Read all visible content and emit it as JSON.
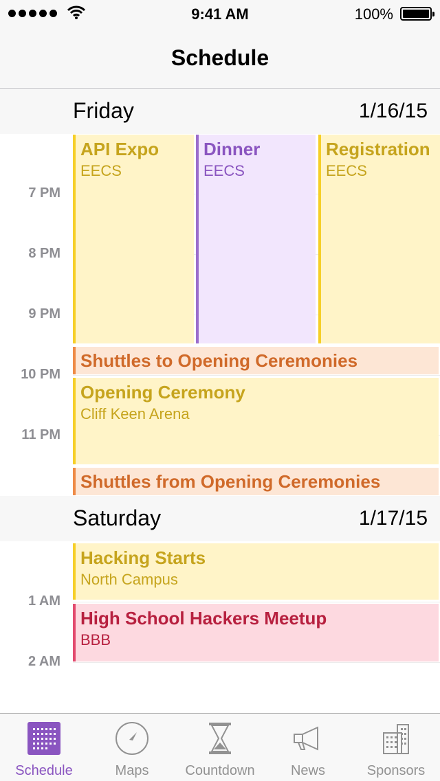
{
  "status_bar": {
    "time": "9:41 AM",
    "battery": "100%",
    "signal_icon": "signal-dots-icon",
    "wifi_icon": "wifi-icon",
    "battery_icon": "battery-icon"
  },
  "nav": {
    "title": "Schedule"
  },
  "days": [
    {
      "name": "Friday",
      "date": "1/16/15"
    },
    {
      "name": "Saturday",
      "date": "1/17/15"
    }
  ],
  "hours": [
    "7 PM",
    "8 PM",
    "9 PM",
    "10 PM",
    "11 PM",
    "1 AM",
    "2 AM"
  ],
  "events": [
    {
      "title": "API Expo",
      "location": "EECS",
      "color": "#f6cf28"
    },
    {
      "title": "Dinner",
      "location": "EECS",
      "color": "#9b6dcc"
    },
    {
      "title": "Registration",
      "location": "EECS",
      "color": "#f6cf28"
    },
    {
      "title": "Shuttles to Opening Ceremonies",
      "color": "#ee8a46"
    },
    {
      "title": "Opening Ceremony",
      "location": "Cliff Keen Arena",
      "color": "#f6cf28"
    },
    {
      "title": "Shuttles from Opening Ceremonies",
      "color": "#ee8a46"
    },
    {
      "title": "Hacking Starts",
      "location": "North Campus",
      "color": "#f6cf28"
    },
    {
      "title": "High School Hackers Meetup",
      "location": "BBB",
      "color": "#e24a6e"
    }
  ],
  "tabs": [
    {
      "label": "Schedule",
      "icon": "calendar-grid-icon",
      "active": true
    },
    {
      "label": "Maps",
      "icon": "compass-icon",
      "active": false
    },
    {
      "label": "Countdown",
      "icon": "hourglass-icon",
      "active": false
    },
    {
      "label": "News",
      "icon": "megaphone-icon",
      "active": false
    },
    {
      "label": "Sponsors",
      "icon": "building-icon",
      "active": false
    }
  ],
  "accent_color": "#8a55c0"
}
